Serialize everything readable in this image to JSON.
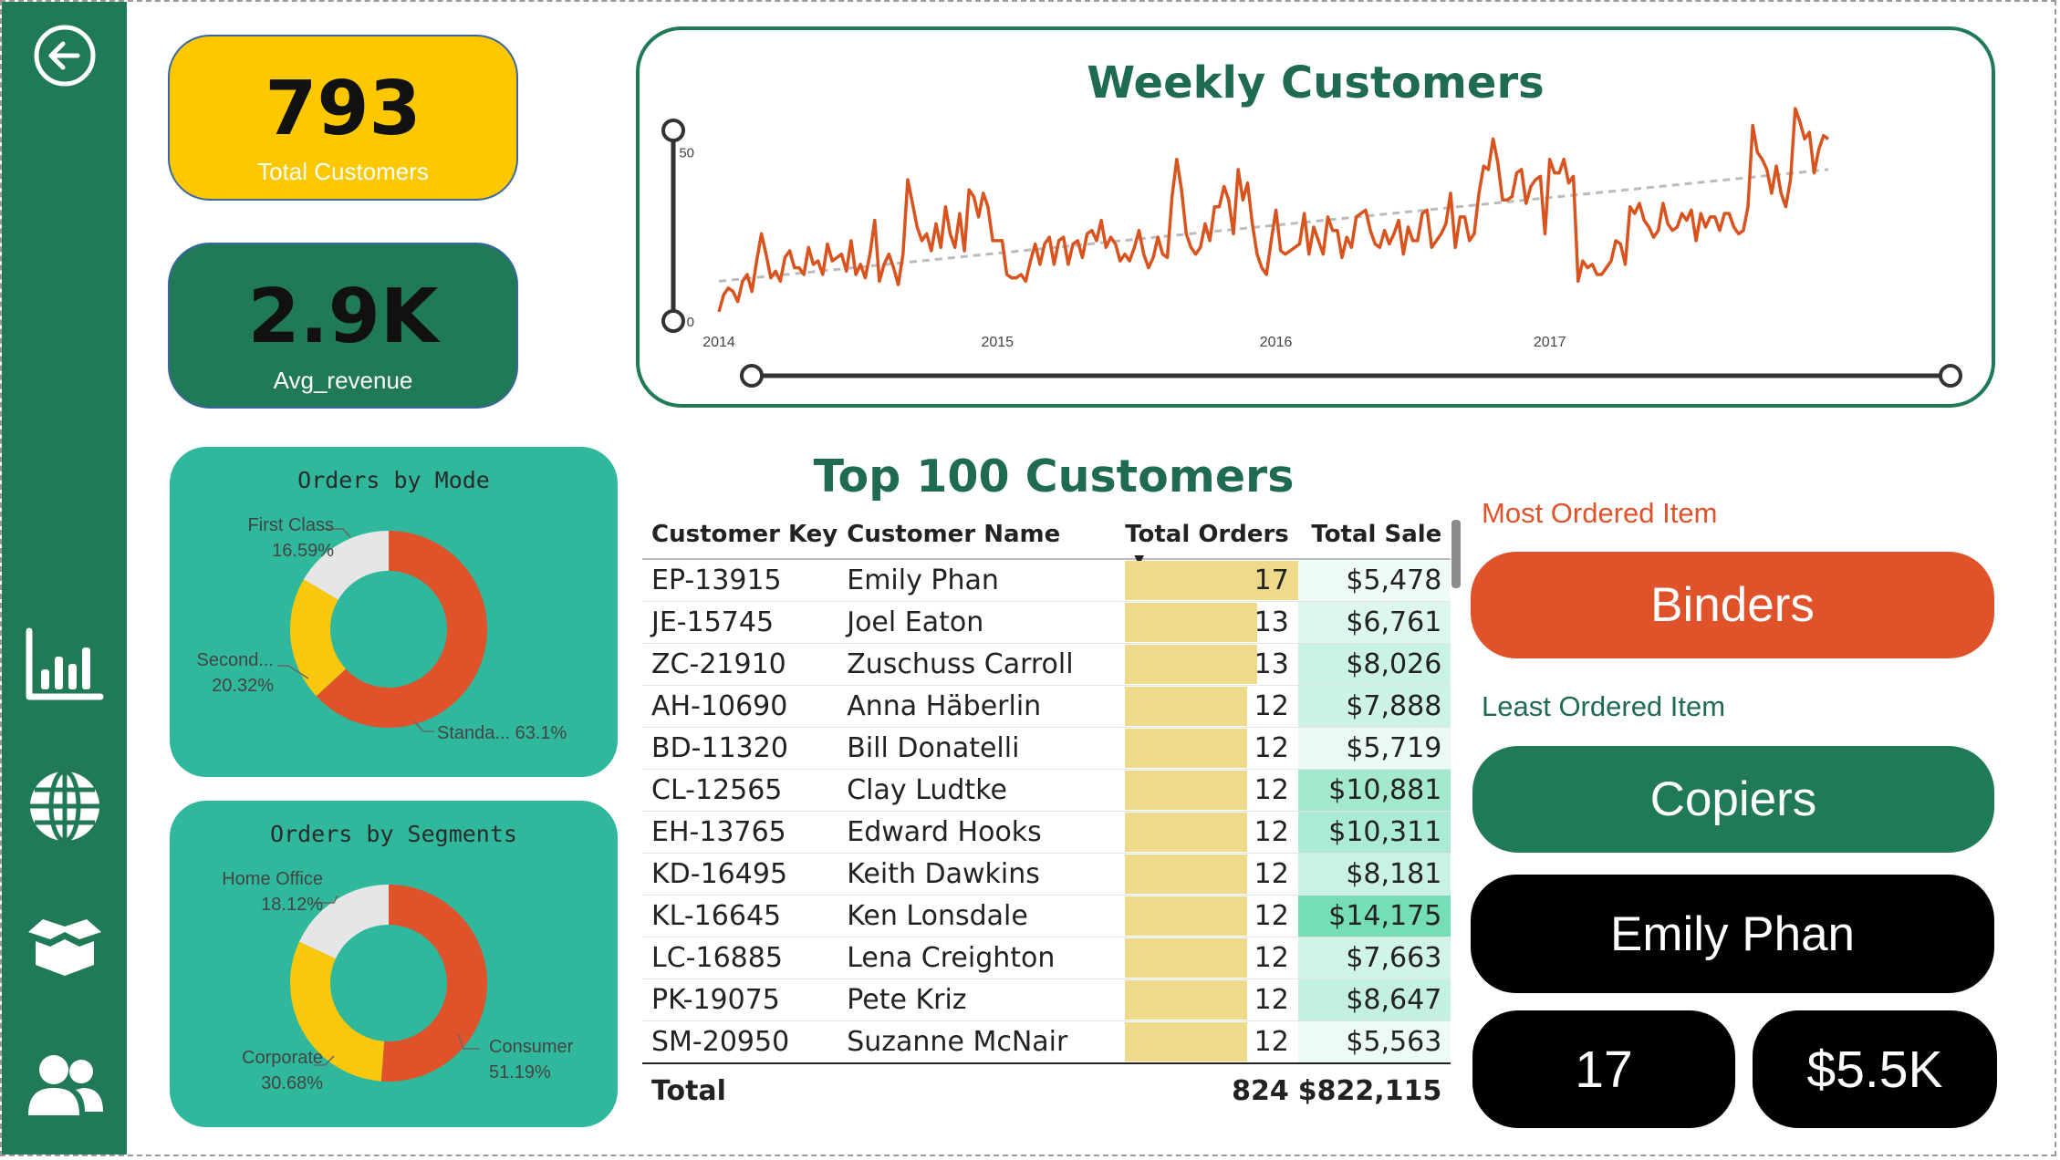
{
  "sidebar": {
    "icons": [
      "back-arrow-icon",
      "bar-chart-icon",
      "globe-icon",
      "box-icon",
      "users-icon"
    ]
  },
  "kpis": {
    "total_customers": {
      "value": "793",
      "label": "Total Customers"
    },
    "avg_revenue": {
      "value": "2.9K",
      "label": "Avg_revenue"
    }
  },
  "colors": {
    "sidebar": "#1f7a55",
    "accent_orange": "#e0522a",
    "accent_yellow": "#fdc800",
    "card_teal": "#2fb89b"
  },
  "orders_by_mode": {
    "title": "Orders by Mode",
    "slices": [
      {
        "label": "Standa...",
        "value": "63.1%",
        "pct": 63.1,
        "color": "#e0522a"
      },
      {
        "label": "Second...",
        "value": "20.32%",
        "pct": 20.32,
        "color": "#f9c80e"
      },
      {
        "label": "First Class",
        "value": "16.59%",
        "pct": 16.59,
        "color": "#e6e6e6"
      }
    ]
  },
  "orders_by_segments": {
    "title": "Orders by Segments",
    "slices": [
      {
        "label": "Consumer",
        "value": "51.19%",
        "pct": 51.19,
        "color": "#e0522a"
      },
      {
        "label": "Corporate",
        "value": "30.68%",
        "pct": 30.68,
        "color": "#f9c80e"
      },
      {
        "label": "Home Office",
        "value": "18.12%",
        "pct": 18.12,
        "color": "#e6e6e6"
      }
    ]
  },
  "chart_data": {
    "type": "line",
    "title": "Weekly Customers",
    "x_ticks": [
      "2014",
      "2015",
      "2016",
      "2017"
    ],
    "y_ticks": [
      "0",
      "50"
    ],
    "ylim": [
      0,
      70
    ],
    "trend_line": {
      "start": 12,
      "end": 45,
      "style": "dashed"
    },
    "series": [
      {
        "color": "#d9531e",
        "values": [
          3,
          8,
          10,
          9,
          6,
          12,
          14,
          9,
          18,
          26,
          20,
          13,
          15,
          12,
          19,
          21,
          16,
          16,
          14,
          22,
          17,
          18,
          14,
          23,
          18,
          19,
          20,
          15,
          24,
          14,
          17,
          13,
          20,
          30,
          12,
          17,
          20,
          16,
          11,
          20,
          42,
          35,
          28,
          24,
          26,
          21,
          29,
          22,
          34,
          26,
          22,
          32,
          21,
          39,
          37,
          31,
          38,
          34,
          24,
          24,
          24,
          14,
          13,
          13,
          14,
          12,
          18,
          23,
          17,
          23,
          25,
          17,
          24,
          25,
          17,
          23,
          24,
          19,
          26,
          27,
          24,
          30,
          22,
          25,
          23,
          18,
          20,
          18,
          22,
          27,
          20,
          16,
          19,
          25,
          20,
          19,
          37,
          48,
          39,
          26,
          22,
          20,
          22,
          29,
          24,
          34,
          34,
          40,
          36,
          26,
          45,
          36,
          41,
          29,
          20,
          16,
          14,
          24,
          33,
          21,
          20,
          21,
          22,
          23,
          32,
          20,
          28,
          24,
          20,
          31,
          27,
          27,
          19,
          25,
          22,
          31,
          32,
          33,
          27,
          23,
          22,
          27,
          23,
          26,
          30,
          20,
          28,
          24,
          24,
          32,
          33,
          22,
          24,
          26,
          29,
          38,
          22,
          31,
          31,
          24,
          26,
          38,
          46,
          45,
          54,
          47,
          36,
          36,
          37,
          44,
          45,
          35,
          40,
          42,
          43,
          26,
          48,
          44,
          44,
          48,
          41,
          43,
          12,
          18,
          16,
          17,
          14,
          14,
          16,
          18,
          24,
          23,
          17,
          34,
          32,
          35,
          30,
          28,
          25,
          27,
          35,
          29,
          27,
          28,
          32,
          30,
          33,
          24,
          32,
          28,
          31,
          31,
          27,
          32,
          32,
          28,
          26,
          27,
          34,
          58,
          50,
          48,
          45,
          38,
          46,
          38,
          34,
          42,
          63,
          59,
          54,
          56,
          44,
          51,
          55,
          54
        ]
      }
    ]
  },
  "table": {
    "title": "Top 100 Customers",
    "headers": {
      "key": "Customer Key",
      "name": "Customer Name",
      "orders": "Total Orders",
      "sale": "Total Sale"
    },
    "rows": [
      {
        "key": "EP-13915",
        "name": "Emily Phan",
        "orders": "17",
        "sale": "$5,478"
      },
      {
        "key": "JE-15745",
        "name": "Joel Eaton",
        "orders": "13",
        "sale": "$6,761"
      },
      {
        "key": "ZC-21910",
        "name": "Zuschuss Carroll",
        "orders": "13",
        "sale": "$8,026"
      },
      {
        "key": "AH-10690",
        "name": "Anna Häberlin",
        "orders": "12",
        "sale": "$7,888"
      },
      {
        "key": "BD-11320",
        "name": "Bill Donatelli",
        "orders": "12",
        "sale": "$5,719"
      },
      {
        "key": "CL-12565",
        "name": "Clay Ludtke",
        "orders": "12",
        "sale": "$10,881"
      },
      {
        "key": "EH-13765",
        "name": "Edward Hooks",
        "orders": "12",
        "sale": "$10,311"
      },
      {
        "key": "KD-16495",
        "name": "Keith Dawkins",
        "orders": "12",
        "sale": "$8,181"
      },
      {
        "key": "KL-16645",
        "name": "Ken Lonsdale",
        "orders": "12",
        "sale": "$14,175"
      },
      {
        "key": "LC-16885",
        "name": "Lena Creighton",
        "orders": "12",
        "sale": "$7,663"
      },
      {
        "key": "PK-19075",
        "name": "Pete Kriz",
        "orders": "12",
        "sale": "$8,647"
      },
      {
        "key": "SM-20950",
        "name": "Suzanne McNair",
        "orders": "12",
        "sale": "$5,563"
      }
    ],
    "total": {
      "label": "Total",
      "orders": "824",
      "sale": "$822,115"
    }
  },
  "right_panel": {
    "most_label": "Most Ordered Item",
    "most_value": "Binders",
    "least_label": "Least Ordered Item",
    "least_value": "Copiers",
    "top_customer": "Emily Phan",
    "top_orders": "17",
    "top_sale": "$5.5K"
  }
}
